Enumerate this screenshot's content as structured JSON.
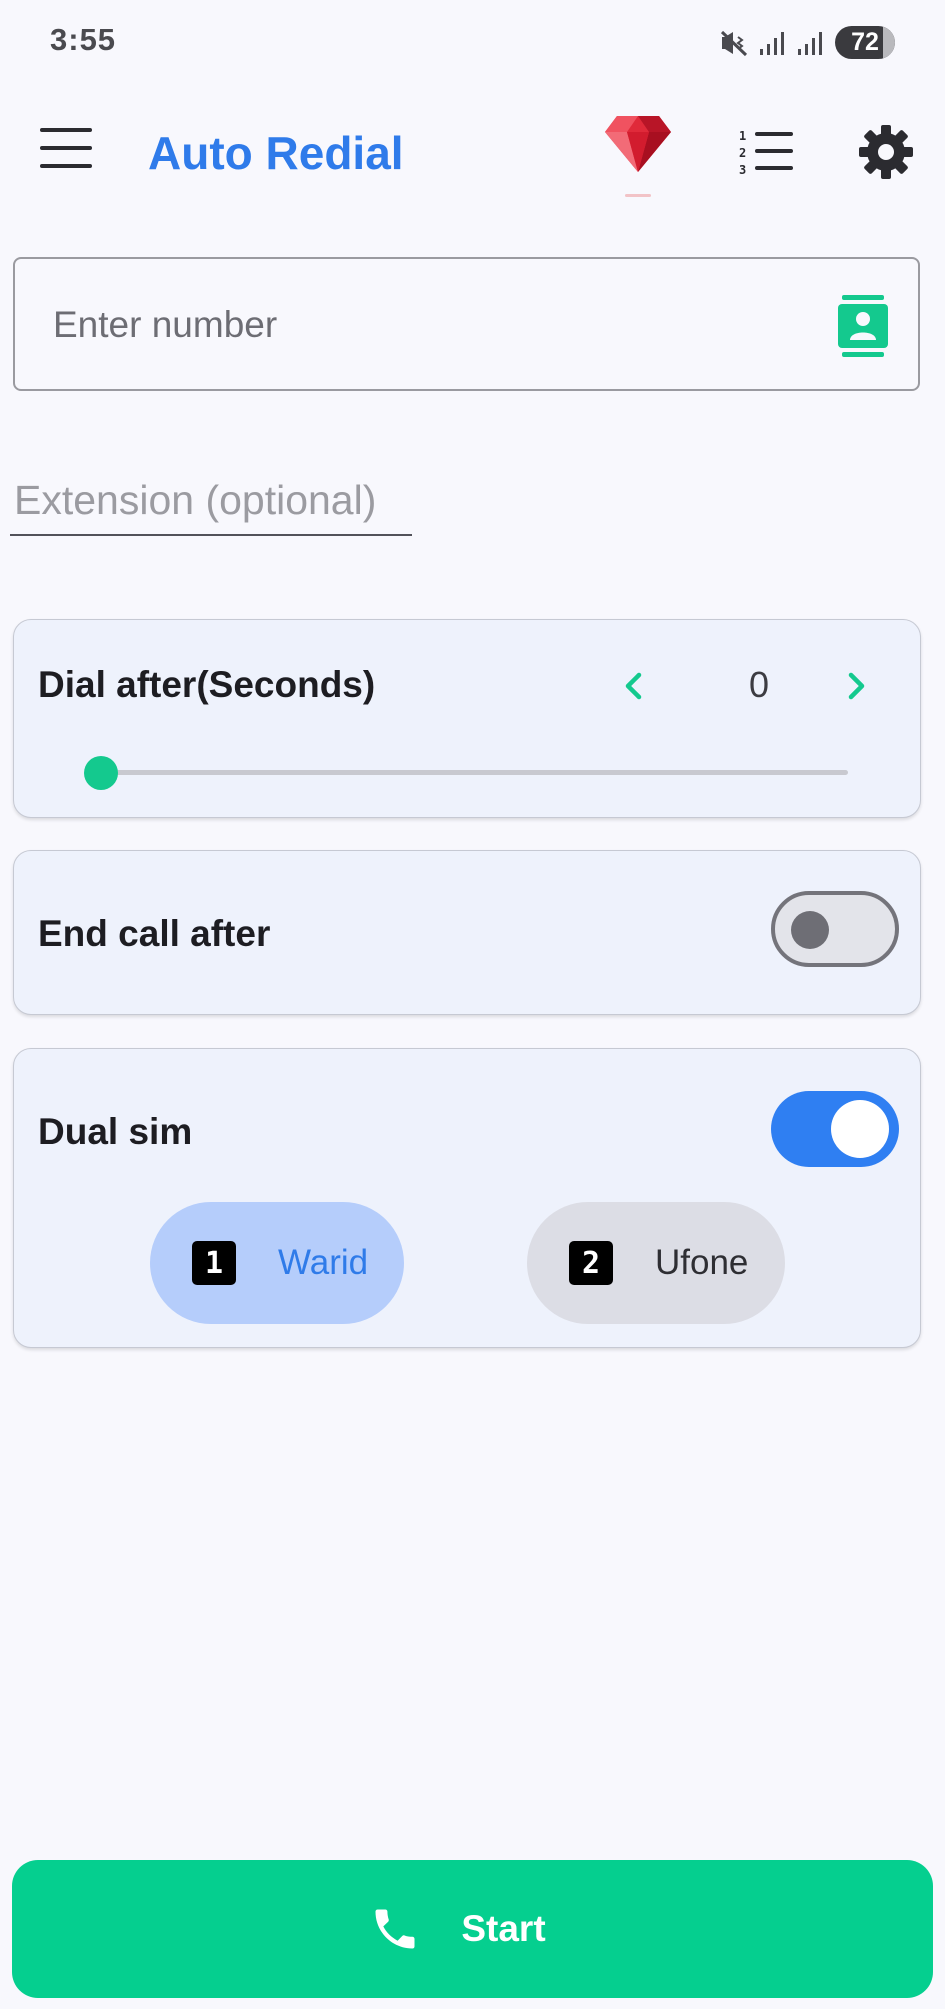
{
  "status_bar": {
    "time": "3:55",
    "battery": "72",
    "icons": [
      "mute-vibrate-icon",
      "signal-icon",
      "signal-icon"
    ]
  },
  "app_bar": {
    "title": "Auto Redial",
    "icons": [
      "menu-icon",
      "gem-icon",
      "numbered-list-icon",
      "gear-icon"
    ]
  },
  "number_input": {
    "placeholder": "Enter number",
    "value": "",
    "icon": "contact-icon"
  },
  "extension_input": {
    "placeholder": "Extension (optional)",
    "value": ""
  },
  "dial_after": {
    "label": "Dial after(Seconds)",
    "value": "0",
    "slider_fraction": 0
  },
  "end_call": {
    "label": "End call after",
    "enabled": false
  },
  "dual_sim": {
    "label": "Dual sim",
    "enabled": true,
    "sims": [
      {
        "badge": "1",
        "name": "Warid",
        "selected": true
      },
      {
        "badge": "2",
        "name": "Ufone",
        "selected": false
      }
    ]
  },
  "start_button": {
    "label": "Start"
  },
  "colors": {
    "accent_blue": "#2f7bea",
    "accent_green": "#05cf8f",
    "card_bg": "#eef2fc",
    "gem_red": "#e02a3a"
  }
}
